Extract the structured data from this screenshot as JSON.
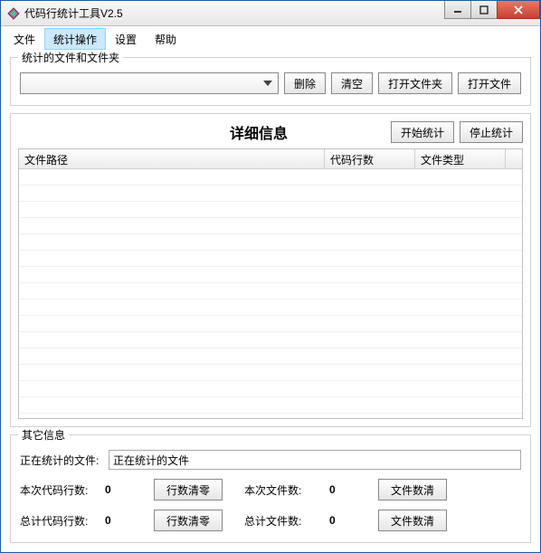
{
  "window": {
    "title": "代码行统计工具V2.5"
  },
  "menu": {
    "file": "文件",
    "stat_op": "统计操作",
    "settings": "设置",
    "help": "帮助"
  },
  "group_files": {
    "title": "统计的文件和文件夹",
    "delete": "删除",
    "clear": "清空",
    "open_folder": "打开文件夹",
    "open_file": "打开文件"
  },
  "detail": {
    "title": "详细信息",
    "start": "开始统计",
    "stop": "停止统计",
    "columns": {
      "path": "文件路径",
      "lines": "代码行数",
      "type": "文件类型"
    }
  },
  "other": {
    "title": "其它信息",
    "current_label": "正在统计的文件:",
    "current_value": "正在统计的文件",
    "this_lines_label": "本次代码行数:",
    "this_lines_value": "0",
    "clear_lines": "行数清零",
    "this_files_label": "本次文件数:",
    "this_files_value": "0",
    "clear_files": "文件数清",
    "total_lines_label": "总计代码行数:",
    "total_lines_value": "0",
    "total_files_label": "总计文件数:",
    "total_files_value": "0"
  }
}
